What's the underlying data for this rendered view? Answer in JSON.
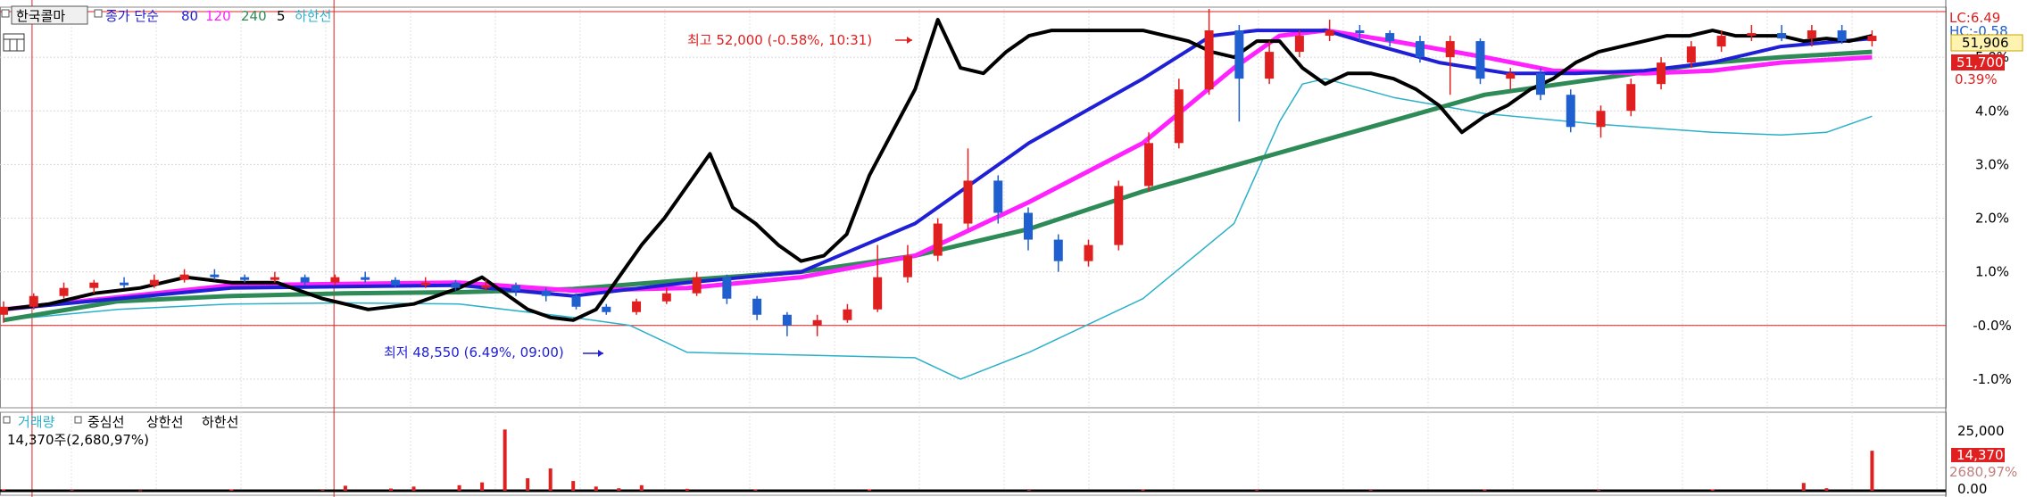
{
  "colors": {
    "ma5": "#000000",
    "ma80": "#1f1fd6",
    "ma120": "#ff22ff",
    "ma240": "#2e8b57",
    "lowline": "#2ab0c8",
    "up": "#e02020",
    "down": "#1f5fd0",
    "hline": "#e02020"
  },
  "chart_data": [
    {
      "type": "candlestick",
      "legend": {
        "symbol": "한국콜마",
        "ma_label": "종가 단순",
        "ma_periods": [
          "80",
          "120",
          "240",
          "5"
        ],
        "lower_band": "하한선"
      },
      "y_ticks": [
        "5.0%",
        "4.0%",
        "3.0%",
        "2.0%",
        "1.0%",
        "-0.0%",
        "-1.0%"
      ],
      "y_range_pct": [
        -1.5,
        5.9
      ],
      "right_labels": {
        "lc": "LC:6.49",
        "hc": "HC:-0.58",
        "current": "51,906",
        "price": "51,700",
        "change": "0.39%"
      },
      "annotations": {
        "high": "최고 52,000 (-0.58%, 10:31)",
        "low": "최저 48,550 (6.49%, 09:00)"
      },
      "ma5": [
        [
          0,
          0.3
        ],
        [
          4,
          0.4
        ],
        [
          8,
          0.6
        ],
        [
          12,
          0.7
        ],
        [
          16,
          0.9
        ],
        [
          20,
          0.8
        ],
        [
          24,
          0.8
        ],
        [
          28,
          0.5
        ],
        [
          32,
          0.3
        ],
        [
          36,
          0.4
        ],
        [
          40,
          0.7
        ],
        [
          42,
          0.9
        ],
        [
          44,
          0.6
        ],
        [
          46,
          0.3
        ],
        [
          48,
          0.15
        ],
        [
          50,
          0.1
        ],
        [
          52,
          0.3
        ],
        [
          54,
          0.9
        ],
        [
          56,
          1.5
        ],
        [
          58,
          2.0
        ],
        [
          60,
          2.6
        ],
        [
          62,
          3.2
        ],
        [
          64,
          2.2
        ],
        [
          66,
          1.9
        ],
        [
          68,
          1.5
        ],
        [
          70,
          1.2
        ],
        [
          72,
          1.3
        ],
        [
          74,
          1.7
        ],
        [
          76,
          2.8
        ],
        [
          78,
          3.6
        ],
        [
          80,
          4.4
        ],
        [
          82,
          5.7
        ],
        [
          84,
          4.8
        ],
        [
          86,
          4.7
        ],
        [
          88,
          5.1
        ],
        [
          90,
          5.4
        ],
        [
          92,
          5.5
        ],
        [
          94,
          5.5
        ],
        [
          96,
          5.5
        ],
        [
          98,
          5.5
        ],
        [
          100,
          5.5
        ],
        [
          102,
          5.4
        ],
        [
          104,
          5.3
        ],
        [
          106,
          5.1
        ],
        [
          108,
          5.0
        ],
        [
          110,
          5.3
        ],
        [
          112,
          5.3
        ],
        [
          114,
          4.8
        ],
        [
          116,
          4.5
        ],
        [
          118,
          4.7
        ],
        [
          120,
          4.7
        ],
        [
          122,
          4.6
        ],
        [
          124,
          4.4
        ],
        [
          126,
          4.1
        ],
        [
          128,
          3.6
        ],
        [
          130,
          3.9
        ],
        [
          132,
          4.1
        ],
        [
          134,
          4.4
        ],
        [
          136,
          4.6
        ],
        [
          138,
          4.9
        ],
        [
          140,
          5.1
        ],
        [
          142,
          5.2
        ],
        [
          144,
          5.3
        ],
        [
          146,
          5.4
        ],
        [
          148,
          5.4
        ],
        [
          150,
          5.5
        ],
        [
          152,
          5.4
        ],
        [
          154,
          5.4
        ],
        [
          156,
          5.4
        ],
        [
          158,
          5.3
        ],
        [
          160,
          5.35
        ],
        [
          162,
          5.3
        ],
        [
          164,
          5.4
        ]
      ],
      "ma80": [
        [
          0,
          0.3
        ],
        [
          20,
          0.7
        ],
        [
          40,
          0.75
        ],
        [
          50,
          0.55
        ],
        [
          60,
          0.8
        ],
        [
          70,
          1.0
        ],
        [
          80,
          1.9
        ],
        [
          90,
          3.4
        ],
        [
          100,
          4.6
        ],
        [
          106,
          5.4
        ],
        [
          110,
          5.5
        ],
        [
          116,
          5.5
        ],
        [
          120,
          5.25
        ],
        [
          126,
          4.9
        ],
        [
          132,
          4.7
        ],
        [
          138,
          4.7
        ],
        [
          144,
          4.75
        ],
        [
          150,
          4.9
        ],
        [
          156,
          5.2
        ],
        [
          164,
          5.35
        ]
      ],
      "ma120": [
        [
          0,
          0.3
        ],
        [
          20,
          0.75
        ],
        [
          40,
          0.8
        ],
        [
          50,
          0.65
        ],
        [
          60,
          0.7
        ],
        [
          70,
          0.9
        ],
        [
          80,
          1.3
        ],
        [
          90,
          2.3
        ],
        [
          100,
          3.4
        ],
        [
          108,
          4.8
        ],
        [
          112,
          5.4
        ],
        [
          116,
          5.5
        ],
        [
          122,
          5.3
        ],
        [
          130,
          5.0
        ],
        [
          136,
          4.75
        ],
        [
          144,
          4.7
        ],
        [
          150,
          4.75
        ],
        [
          156,
          4.9
        ],
        [
          164,
          5.0
        ]
      ],
      "ma240": [
        [
          0,
          0.1
        ],
        [
          10,
          0.45
        ],
        [
          20,
          0.55
        ],
        [
          30,
          0.6
        ],
        [
          40,
          0.62
        ],
        [
          50,
          0.68
        ],
        [
          60,
          0.85
        ],
        [
          70,
          1.0
        ],
        [
          80,
          1.3
        ],
        [
          90,
          1.8
        ],
        [
          100,
          2.5
        ],
        [
          110,
          3.1
        ],
        [
          120,
          3.7
        ],
        [
          130,
          4.3
        ],
        [
          140,
          4.6
        ],
        [
          150,
          4.9
        ],
        [
          156,
          5.0
        ],
        [
          164,
          5.1
        ]
      ],
      "lowline": [
        [
          0,
          0.1
        ],
        [
          10,
          0.3
        ],
        [
          20,
          0.4
        ],
        [
          30,
          0.42
        ],
        [
          40,
          0.4
        ],
        [
          50,
          0.15
        ],
        [
          55,
          0.0
        ],
        [
          60,
          -0.5
        ],
        [
          70,
          -0.55
        ],
        [
          80,
          -0.6
        ],
        [
          84,
          -1.0
        ],
        [
          90,
          -0.5
        ],
        [
          100,
          0.5
        ],
        [
          108,
          1.9
        ],
        [
          112,
          3.8
        ],
        [
          114,
          4.5
        ],
        [
          116,
          4.6
        ],
        [
          122,
          4.25
        ],
        [
          130,
          3.95
        ],
        [
          140,
          3.75
        ],
        [
          150,
          3.6
        ],
        [
          156,
          3.55
        ],
        [
          160,
          3.6
        ],
        [
          164,
          3.9
        ]
      ],
      "candles": [
        [
          0,
          0.2,
          0.35,
          0.45,
          0.05
        ],
        [
          1,
          0.35,
          0.55,
          0.6,
          0.3
        ],
        [
          2,
          0.55,
          0.7,
          0.8,
          0.5
        ],
        [
          3,
          0.7,
          0.8,
          0.85,
          0.6
        ],
        [
          4,
          0.8,
          0.75,
          0.9,
          0.7
        ],
        [
          5,
          0.75,
          0.85,
          0.95,
          0.7
        ],
        [
          6,
          0.85,
          0.95,
          1.05,
          0.8
        ],
        [
          7,
          0.95,
          0.9,
          1.05,
          0.85
        ],
        [
          8,
          0.9,
          0.85,
          0.95,
          0.8
        ],
        [
          9,
          0.85,
          0.9,
          1.0,
          0.8
        ],
        [
          10,
          0.9,
          0.8,
          0.95,
          0.75
        ],
        [
          11,
          0.8,
          0.9,
          0.95,
          0.75
        ],
        [
          12,
          0.9,
          0.85,
          1.0,
          0.8
        ],
        [
          13,
          0.85,
          0.75,
          0.9,
          0.7
        ],
        [
          14,
          0.75,
          0.8,
          0.9,
          0.7
        ],
        [
          15,
          0.8,
          0.7,
          0.85,
          0.65
        ],
        [
          16,
          0.7,
          0.75,
          0.85,
          0.65
        ],
        [
          17,
          0.75,
          0.65,
          0.8,
          0.55
        ],
        [
          18,
          0.65,
          0.55,
          0.7,
          0.45
        ],
        [
          19,
          0.55,
          0.35,
          0.6,
          0.3
        ],
        [
          20,
          0.35,
          0.25,
          0.4,
          0.2
        ],
        [
          21,
          0.25,
          0.45,
          0.5,
          0.2
        ],
        [
          22,
          0.45,
          0.6,
          0.7,
          0.4
        ],
        [
          23,
          0.6,
          0.9,
          1.0,
          0.55
        ],
        [
          24,
          0.9,
          0.5,
          0.95,
          0.4
        ],
        [
          25,
          0.5,
          0.2,
          0.55,
          0.1
        ],
        [
          26,
          0.2,
          0.0,
          0.25,
          -0.2
        ],
        [
          27,
          0.0,
          0.1,
          0.2,
          -0.2
        ],
        [
          28,
          0.1,
          0.3,
          0.4,
          0.05
        ],
        [
          29,
          0.3,
          0.9,
          1.5,
          0.25
        ],
        [
          30,
          0.9,
          1.3,
          1.5,
          0.8
        ],
        [
          31,
          1.3,
          1.9,
          2.0,
          1.2
        ],
        [
          32,
          1.9,
          2.7,
          3.3,
          1.8
        ],
        [
          33,
          2.7,
          2.1,
          2.8,
          1.9
        ],
        [
          34,
          2.1,
          1.6,
          2.2,
          1.4
        ],
        [
          35,
          1.6,
          1.2,
          1.7,
          1.0
        ],
        [
          36,
          1.2,
          1.5,
          1.6,
          1.1
        ],
        [
          37,
          1.5,
          2.6,
          2.7,
          1.4
        ],
        [
          38,
          2.6,
          3.4,
          3.6,
          2.5
        ],
        [
          39,
          3.4,
          4.4,
          4.6,
          3.3
        ],
        [
          40,
          4.4,
          5.5,
          5.9,
          4.3
        ],
        [
          41,
          5.5,
          4.6,
          5.6,
          3.8
        ],
        [
          42,
          4.6,
          5.1,
          5.3,
          4.5
        ],
        [
          43,
          5.1,
          5.4,
          5.5,
          5.0
        ],
        [
          44,
          5.4,
          5.5,
          5.7,
          5.3
        ],
        [
          45,
          5.5,
          5.45,
          5.6,
          5.3
        ],
        [
          46,
          5.45,
          5.3,
          5.5,
          5.2
        ],
        [
          47,
          5.3,
          5.0,
          5.4,
          4.9
        ],
        [
          48,
          5.0,
          5.3,
          5.4,
          4.3
        ],
        [
          49,
          5.3,
          4.6,
          5.35,
          4.5
        ],
        [
          50,
          4.6,
          4.7,
          4.8,
          4.4
        ],
        [
          51,
          4.7,
          4.3,
          4.8,
          4.2
        ],
        [
          52,
          4.3,
          3.7,
          4.4,
          3.6
        ],
        [
          53,
          3.7,
          4.0,
          4.1,
          3.5
        ],
        [
          54,
          4.0,
          4.5,
          4.6,
          3.9
        ],
        [
          55,
          4.5,
          4.9,
          5.0,
          4.4
        ],
        [
          56,
          4.9,
          5.2,
          5.3,
          4.8
        ],
        [
          57,
          5.2,
          5.4,
          5.5,
          5.1
        ],
        [
          58,
          5.4,
          5.45,
          5.6,
          5.3
        ],
        [
          59,
          5.45,
          5.35,
          5.6,
          5.3
        ],
        [
          60,
          5.35,
          5.5,
          5.6,
          5.2
        ],
        [
          61,
          5.5,
          5.3,
          5.6,
          5.25
        ],
        [
          62,
          5.3,
          5.4,
          5.5,
          5.2
        ]
      ]
    },
    {
      "type": "bar",
      "legend": [
        "거래량",
        "중심선",
        "상한선",
        "하한선"
      ],
      "volume_text": "14,370주(2,680,97%)",
      "y_ticks": [
        "25,000",
        "0.00"
      ],
      "right_labels": {
        "volume": "14,370",
        "pct": "2680,97%"
      },
      "ylim": [
        0,
        25000
      ],
      "values": [
        [
          0,
          400
        ],
        [
          6,
          300
        ],
        [
          12,
          200
        ],
        [
          20,
          500
        ],
        [
          28,
          300
        ],
        [
          30,
          1800
        ],
        [
          34,
          800
        ],
        [
          36,
          1500
        ],
        [
          40,
          2000
        ],
        [
          42,
          3000
        ],
        [
          44,
          22000
        ],
        [
          46,
          4500
        ],
        [
          48,
          8000
        ],
        [
          50,
          3500
        ],
        [
          52,
          1500
        ],
        [
          54,
          900
        ],
        [
          56,
          2000
        ],
        [
          60,
          700
        ],
        [
          66,
          400
        ],
        [
          76,
          500
        ],
        [
          90,
          300
        ],
        [
          100,
          400
        ],
        [
          110,
          300
        ],
        [
          120,
          300
        ],
        [
          130,
          400
        ],
        [
          140,
          300
        ],
        [
          150,
          500
        ],
        [
          158,
          2800
        ],
        [
          160,
          900
        ],
        [
          164,
          14370
        ]
      ]
    }
  ]
}
